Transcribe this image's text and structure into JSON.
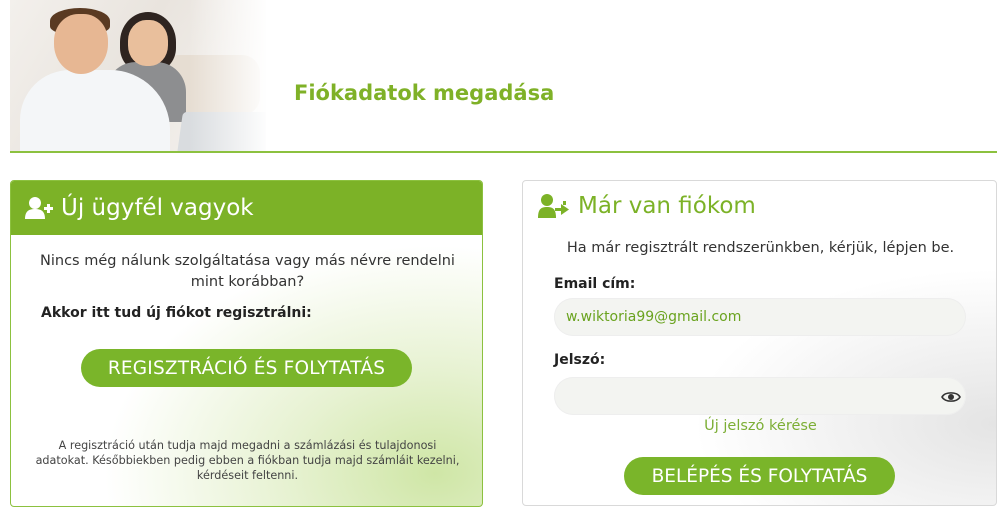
{
  "header": {
    "title": "Fiókadatok megadása"
  },
  "new_customer": {
    "title": "Új ügyfél vagyok",
    "icon": "user-plus-icon",
    "intro": "Nincs még nálunk szolgáltatása vagy más névre rendelni mint korábban?",
    "register_prompt": "Akkor itt tud új fiókot regisztrálni:",
    "register_button": "REGISZTRÁCIÓ ÉS FOLYTATÁS",
    "note": "A regisztráció után tudja majd megadni a számlázási és tulajdonosi adatokat. Későbbiekben pedig ebben a fiókban tudja majd számláit kezelni, kérdéseit feltenni."
  },
  "login": {
    "title": "Már van fiókom",
    "icon": "sign-in-icon",
    "intro": "Ha már regisztrált rendszerünkben, kérjük, lépjen be.",
    "email_label": "Email cím:",
    "email_value": "w.wiktoria99@gmail.com",
    "password_label": "Jelszó:",
    "password_value": "",
    "show_password_icon": "eye-icon",
    "forgot_link": "Új jelszó kérése",
    "login_button": "BELÉPÉS ÉS FOLYTATÁS"
  },
  "colors": {
    "accent": "#7cb227",
    "accent_light": "#8cc13f",
    "link": "#7cae35"
  }
}
